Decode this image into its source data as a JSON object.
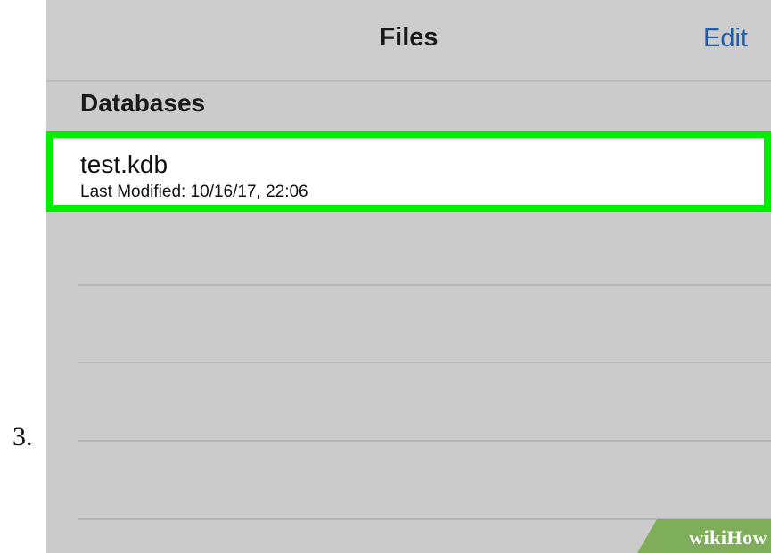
{
  "step": {
    "number": "3."
  },
  "nav": {
    "title": "Files",
    "edit_label": "Edit"
  },
  "section": {
    "header": "Databases"
  },
  "files": [
    {
      "name": "test.kdb",
      "modified": "Last Modified: 10/16/17, 22:06",
      "highlight_color": "#00ee00"
    }
  ],
  "watermark": {
    "text_part1": "wiki",
    "text_part2": "How",
    "color": "#7fae5a"
  }
}
